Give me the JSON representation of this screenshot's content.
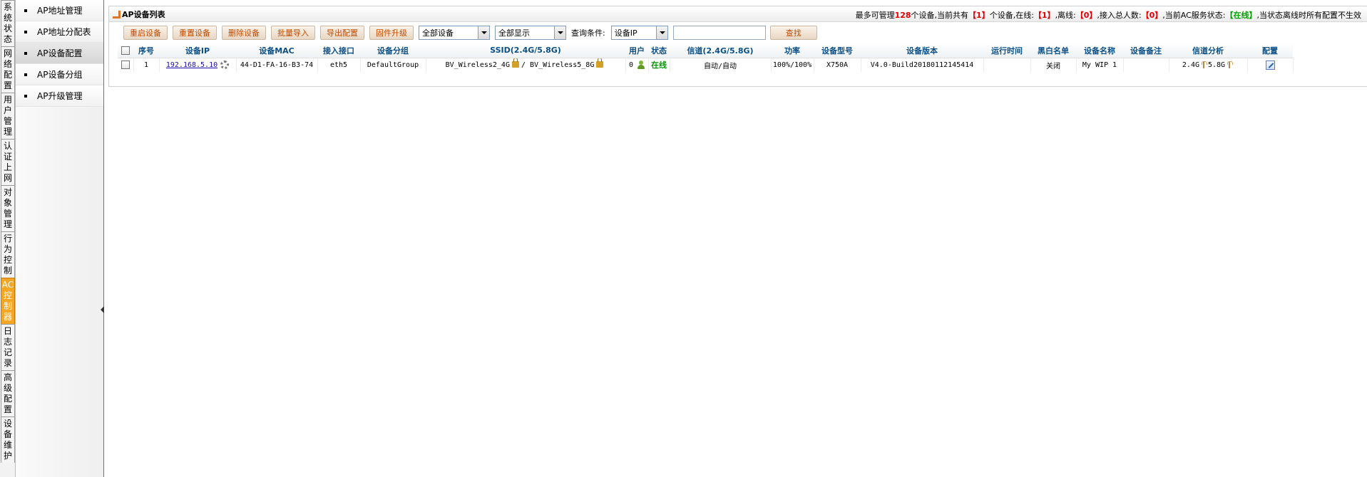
{
  "vertical_tabs": [
    {
      "label": "系统状态",
      "active": false
    },
    {
      "label": "网络配置",
      "active": false
    },
    {
      "label": "用户管理",
      "active": false
    },
    {
      "label": "认证上网",
      "active": false
    },
    {
      "label": "对象管理",
      "active": false
    },
    {
      "label": "行为控制",
      "active": false
    },
    {
      "label": "AC控制器",
      "active": true
    },
    {
      "label": "日志记录",
      "active": false
    },
    {
      "label": "高级配置",
      "active": false
    },
    {
      "label": "设备维护",
      "active": false
    }
  ],
  "submenu": [
    {
      "label": "AP地址管理",
      "active": false
    },
    {
      "label": "AP地址分配表",
      "active": false
    },
    {
      "label": "AP设备配置",
      "active": true
    },
    {
      "label": "AP设备分组",
      "active": false
    },
    {
      "label": "AP升级管理",
      "active": false
    }
  ],
  "panel": {
    "title": "AP设备列表",
    "status": {
      "max_prefix": "最多可管理",
      "max_value": "128",
      "max_suffix": "个设备,当前共有",
      "total_value": "【1】",
      "total_suffix": "个设备,在线:",
      "online_value": "【1】",
      "offline_label": ",离线:",
      "offline_value": "【0】",
      "users_label": ",接入总人数:",
      "users_value": "【0】",
      "ac_label": ",当前AC服务状态:",
      "ac_value": "【在线】",
      "tail": ",当状态离线时所有配置不生效"
    }
  },
  "toolbar": {
    "buttons": [
      "重启设备",
      "重置设备",
      "删除设备",
      "批量导入",
      "导出配置",
      "固件升级"
    ],
    "filter_device": "全部设备",
    "filter_display": "全部显示",
    "query_label": "查询条件:",
    "query_field": "设备IP",
    "query_value": "",
    "search_label": "查找"
  },
  "table": {
    "headers": [
      "",
      "序号",
      "设备IP",
      "设备MAC",
      "接入接口",
      "设备分组",
      "SSID(2.4G/5.8G)",
      "用户",
      "状态",
      "信道(2.4G/5.8G)",
      "功率",
      "设备型号",
      "设备版本",
      "运行时间",
      "黑白名单",
      "设备名称",
      "设备备注",
      "信道分析",
      "配置"
    ],
    "rows": [
      {
        "index": "1",
        "ip": "192.168.5.10",
        "mac": "44-D1-FA-16-B3-74",
        "interface": "eth5",
        "group": "DefaultGroup",
        "ssid_24": "BV_Wireless2_4G",
        "ssid_sep": "/",
        "ssid_58": "BV_Wireless5_8G",
        "users": "0",
        "status": "在线",
        "channel": "自动/自动",
        "power": "100%/100%",
        "model": "X750A",
        "version": "V4.0-Build20180112145414",
        "uptime": "",
        "blacklist": "关闭",
        "name": "My WIP 1",
        "remark": "",
        "analysis_24": "2.4G",
        "analysis_58": "5.8G"
      }
    ]
  },
  "colors": {
    "accent_orange": "#f5a623",
    "header_blue": "#0b4f86",
    "status_red": "#e00000",
    "status_green": "#00a000"
  }
}
